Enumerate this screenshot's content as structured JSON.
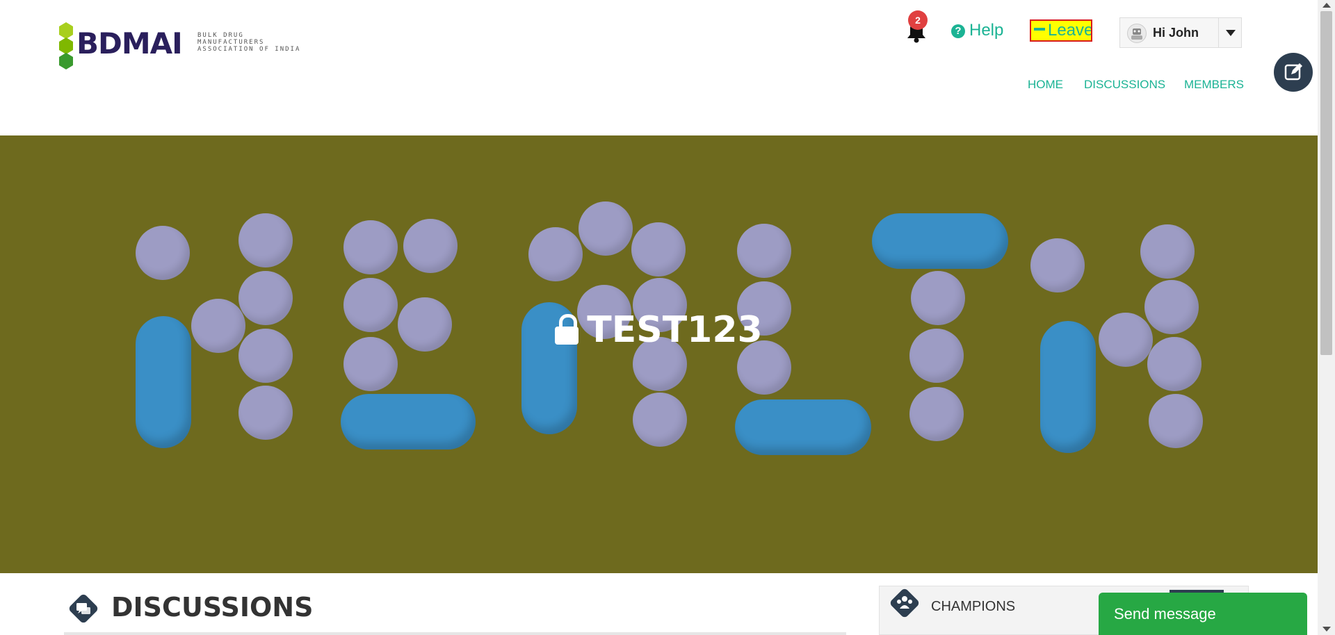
{
  "header": {
    "logo_text": "BDMAI",
    "logo_subtitle": "BULK DRUG\nMANUFACTURERS\nASSOCIATION OF INDIA",
    "notifications": {
      "count": "2",
      "icon": "bell-icon"
    },
    "help_label": "Help",
    "leave_label": "Leave",
    "user": {
      "greeting": "Hi John"
    },
    "nav": [
      "HOME",
      "DISCUSSIONS",
      "MEMBERS"
    ]
  },
  "hero": {
    "title": "TEST123",
    "overlay_color": "#6e6a1e"
  },
  "discussions": {
    "title": "DISCUSSIONS"
  },
  "champions": {
    "title": "CHAMPIONS"
  },
  "chat": {
    "send_label": "Send message"
  },
  "colors": {
    "accent": "#1bb394",
    "badge": "#e04040",
    "send_button": "#27a844",
    "dark": "#2d3e50",
    "leave_highlight": "#ffff00"
  }
}
